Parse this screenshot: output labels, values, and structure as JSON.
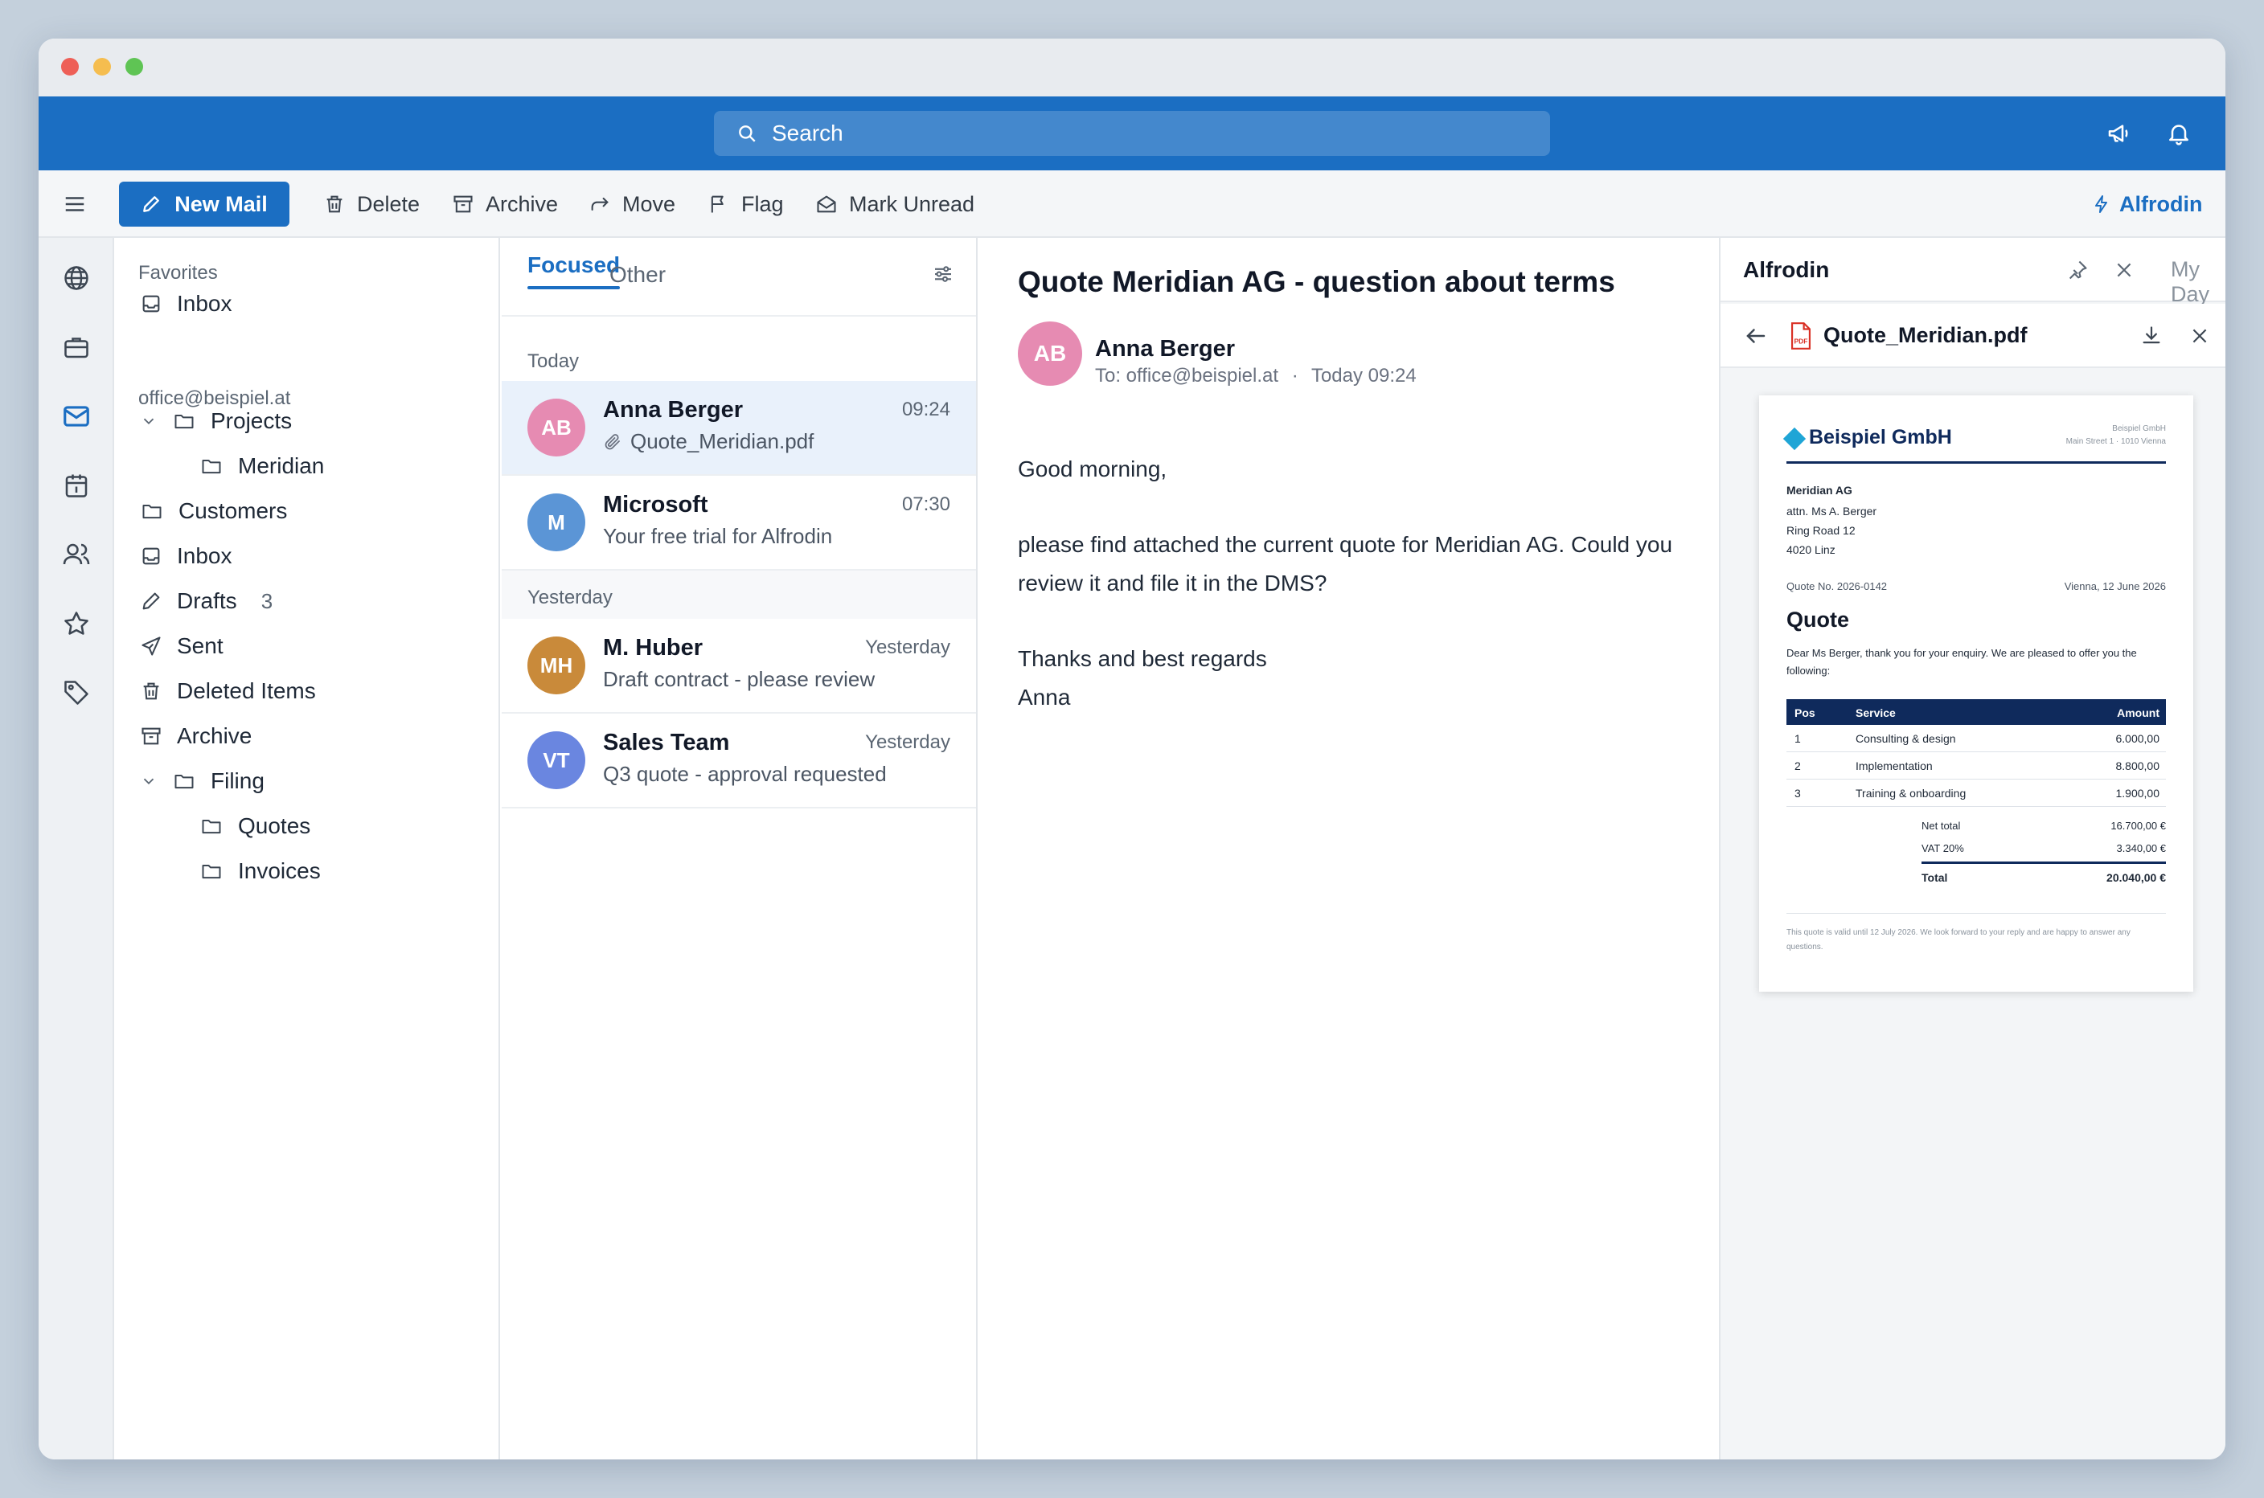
{
  "search": {
    "placeholder": "Search"
  },
  "toolbar": {
    "new_mail": "New Mail",
    "delete": "Delete",
    "archive": "Archive",
    "move": "Move",
    "flag": "Flag",
    "mark_unread": "Mark Unread",
    "alfrodin": "Alfrodin"
  },
  "folders": {
    "favorites_label": "Favorites",
    "favorites_inbox": "Inbox",
    "account": "office@beispiel.at",
    "projects": "Projects",
    "meridian": "Meridian",
    "customers": "Customers",
    "inbox": "Inbox",
    "drafts": "Drafts",
    "drafts_count": "3",
    "sent": "Sent",
    "deleted": "Deleted Items",
    "archive": "Archive",
    "filing": "Filing",
    "quotes": "Quotes",
    "invoices": "Invoices"
  },
  "list": {
    "tab_focused": "Focused",
    "tab_other": "Other",
    "today": "Today",
    "yesterday": "Yesterday",
    "messages": [
      {
        "initials": "AB",
        "from": "Anna Berger",
        "time": "09:24",
        "subject": "Quote_Meridian.pdf",
        "color": "#e68bb2"
      },
      {
        "initials": "M",
        "from": "Microsoft",
        "time": "07:30",
        "subject": "Your free trial for Alfrodin",
        "color": "#5b95d6"
      },
      {
        "initials": "MH",
        "from": "M. Huber",
        "time": "Yesterday",
        "subject": "Draft contract - please review",
        "color": "#c98a3a"
      },
      {
        "initials": "VT",
        "from": "Sales Team",
        "time": "Yesterday",
        "subject": "Q3 quote - approval requested",
        "color": "#6a86e0"
      }
    ]
  },
  "reading": {
    "subject": "Quote Meridian AG - question about terms",
    "avatar": "AB",
    "sender": "Anna Berger",
    "to": "To: office@beispiel.at",
    "sep": "·",
    "date": "Today 09:24",
    "greeting": "Good morning,",
    "paragraph": "please find attached the current quote for Meridian AG. Could you review it and file it in the DMS?",
    "closing1": "Thanks and best regards",
    "closing2": "Anna"
  },
  "pane": {
    "title": "Alfrodin",
    "my_day": "My Day",
    "file_name": "Quote_Meridian.pdf",
    "pdf_badge": "PDF"
  },
  "doc": {
    "company": "Beispiel GmbH",
    "company_small": "Beispiel GmbH",
    "address_small": "Main Street 1 · 1010 Vienna",
    "recipient_name": "Meridian AG",
    "recipient_line1": "attn. Ms A. Berger",
    "recipient_line2": "Ring Road 12",
    "recipient_line3": "4020 Linz",
    "quote_no": "Quote No. 2026-0142",
    "place_date": "Vienna, 12 June 2026",
    "heading": "Quote",
    "intro": "Dear Ms Berger, thank you for your enquiry. We are pleased to offer you the following:",
    "col_pos": "Pos",
    "col_service": "Service",
    "col_amount": "Amount",
    "rows": [
      {
        "pos": "1",
        "service": "Consulting & design",
        "amount": "6.000,00"
      },
      {
        "pos": "2",
        "service": "Implementation",
        "amount": "8.800,00"
      },
      {
        "pos": "3",
        "service": "Training & onboarding",
        "amount": "1.900,00"
      }
    ],
    "net_label": "Net total",
    "net_value": "16.700,00 €",
    "vat_label": "VAT 20%",
    "vat_value": "3.340,00 €",
    "total_label": "Total",
    "total_value": "20.040,00 €",
    "footer": "This quote is valid until 12 July 2026. We look forward to your reply and are happy to answer any questions."
  },
  "colors": {
    "brand": "#1b6ec2",
    "navy": "#0f2a5c",
    "accent_diamond": "#1fa5d6",
    "selected_row": "#e9f1fb"
  }
}
